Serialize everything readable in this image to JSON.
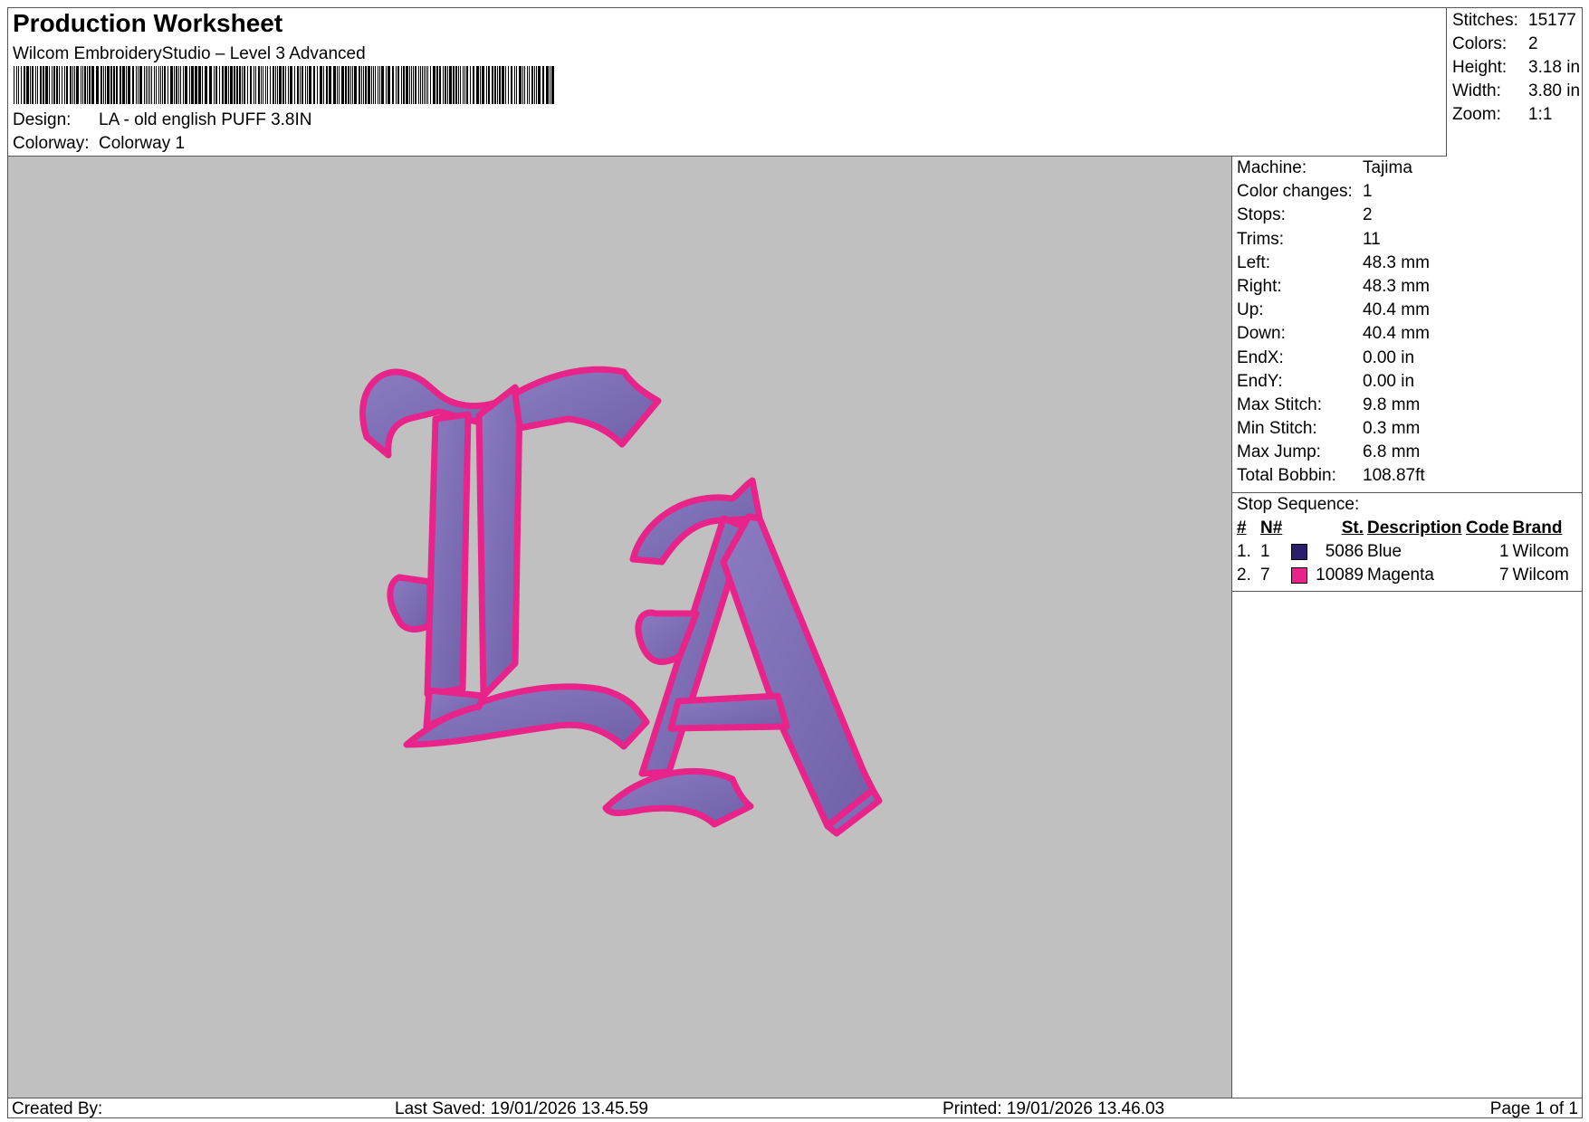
{
  "header": {
    "title": "Production Worksheet",
    "subtitle": "Wilcom EmbroideryStudio – Level 3 Advanced",
    "design_label": "Design:",
    "design_value": "LA - old english PUFF 3.8IN",
    "colorway_label": "Colorway:",
    "colorway_value": "Colorway 1"
  },
  "stats": [
    {
      "label": "Stitches:",
      "value": "15177"
    },
    {
      "label": "Colors:",
      "value": "2"
    },
    {
      "label": "Height:",
      "value": "3.18 in"
    },
    {
      "label": "Width:",
      "value": "3.80 in"
    },
    {
      "label": "Zoom:",
      "value": "1:1"
    }
  ],
  "info": [
    {
      "label": "Machine:",
      "value": "Tajima"
    },
    {
      "label": "Color changes:",
      "value": "1"
    },
    {
      "label": "Stops:",
      "value": "2"
    },
    {
      "label": "Trims:",
      "value": "11"
    },
    {
      "label": "Left:",
      "value": "48.3 mm"
    },
    {
      "label": "Right:",
      "value": "48.3 mm"
    },
    {
      "label": "Up:",
      "value": "40.4 mm"
    },
    {
      "label": "Down:",
      "value": "40.4 mm"
    },
    {
      "label": "EndX:",
      "value": "0.00 in"
    },
    {
      "label": "EndY:",
      "value": "0.00 in"
    },
    {
      "label": "Max Stitch:",
      "value": "9.8 mm"
    },
    {
      "label": "Min Stitch:",
      "value": "0.3 mm"
    },
    {
      "label": "Max Jump:",
      "value": "6.8 mm"
    },
    {
      "label": "Total Bobbin:",
      "value": "108.87ft"
    }
  ],
  "stop_sequence": {
    "title": "Stop Sequence:",
    "headers": {
      "num": "#",
      "n": "N#",
      "st": "St.",
      "desc": "Description",
      "code": "Code",
      "brand": "Brand"
    },
    "rows": [
      {
        "num": "1.",
        "n": "1",
        "color": "#2b1f6b",
        "st": "5086",
        "desc": "Blue",
        "code": "1",
        "brand": "Wilcom"
      },
      {
        "num": "2.",
        "n": "7",
        "color": "#e8238a",
        "st": "10089",
        "desc": "Magenta",
        "code": "7",
        "brand": "Wilcom"
      }
    ]
  },
  "design_colors": {
    "fill": "#7e6fb5",
    "outline": "#e8238a",
    "shade": "#4a3d8a",
    "background": "#c0c0c0"
  },
  "footer": {
    "created_by": "Created By:",
    "last_saved": "Last Saved: 19/01/2026 13.45.59",
    "printed": "Printed: 19/01/2026 13.46.03",
    "page": "Page 1 of 1"
  }
}
